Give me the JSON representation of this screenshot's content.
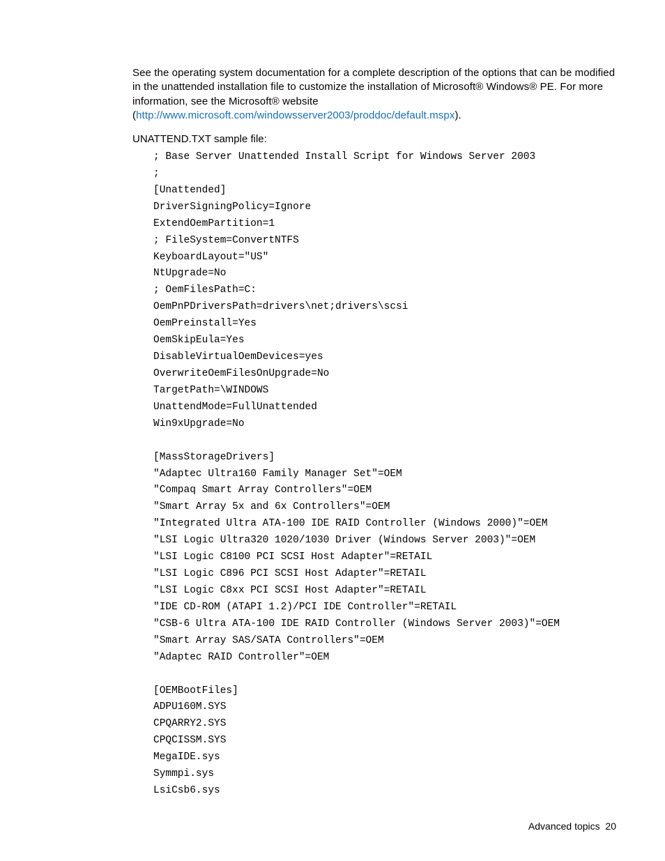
{
  "intro": {
    "text_before_link": "See the operating system documentation for a complete description of the options that can be modified in the unattended installation file to customize the installation of Microsoft® Windows® PE. For more information, see the Microsoft® website (",
    "link_text": "http://www.microsoft.com/windowsserver2003/proddoc/default.mspx",
    "text_after_link": ")."
  },
  "sample_label": "UNATTEND.TXT sample file:",
  "code": "; Base Server Unattended Install Script for Windows Server 2003\n;\n[Unattended]\nDriverSigningPolicy=Ignore\nExtendOemPartition=1\n; FileSystem=ConvertNTFS\nKeyboardLayout=\"US\"\nNtUpgrade=No\n; OemFilesPath=C:\nOemPnPDriversPath=drivers\\net;drivers\\scsi\nOemPreinstall=Yes\nOemSkipEula=Yes\nDisableVirtualOemDevices=yes\nOverwriteOemFilesOnUpgrade=No\nTargetPath=\\WINDOWS\nUnattendMode=FullUnattended\nWin9xUpgrade=No\n\n[MassStorageDrivers]\n\"Adaptec Ultra160 Family Manager Set\"=OEM\n\"Compaq Smart Array Controllers\"=OEM\n\"Smart Array 5x and 6x Controllers\"=OEM\n\"Integrated Ultra ATA-100 IDE RAID Controller (Windows 2000)\"=OEM\n\"LSI Logic Ultra320 1020/1030 Driver (Windows Server 2003)\"=OEM\n\"LSI Logic C8100 PCI SCSI Host Adapter\"=RETAIL\n\"LSI Logic C896 PCI SCSI Host Adapter\"=RETAIL\n\"LSI Logic C8xx PCI SCSI Host Adapter\"=RETAIL\n\"IDE CD-ROM (ATAPI 1.2)/PCI IDE Controller\"=RETAIL\n\"CSB-6 Ultra ATA-100 IDE RAID Controller (Windows Server 2003)\"=OEM\n\"Smart Array SAS/SATA Controllers\"=OEM\n\"Adaptec RAID Controller\"=OEM\n\n[OEMBootFiles]\nADPU160M.SYS\nCPQARRY2.SYS\nCPQCISSM.SYS\nMegaIDE.sys\nSymmpi.sys\nLsiCsb6.sys",
  "footer": {
    "section": "Advanced topics",
    "page": "20"
  }
}
